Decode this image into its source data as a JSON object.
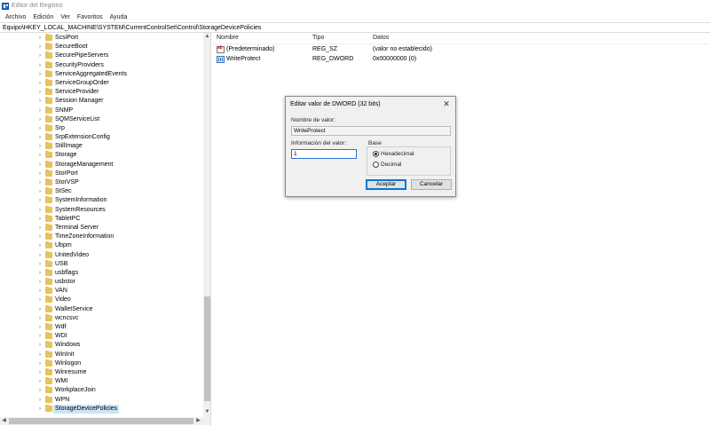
{
  "window": {
    "title": "Editor del Registro"
  },
  "menu": [
    "Archivo",
    "Edición",
    "Ver",
    "Favoritos",
    "Ayuda"
  ],
  "address": "Equipo\\HKEY_LOCAL_MACHINE\\SYSTEM\\CurrentControlSet\\Control\\StorageDevicePolicies",
  "tree": {
    "items": [
      "ScsiPort",
      "SecureBoot",
      "SecurePipeServers",
      "SecurityProviders",
      "ServiceAggregatedEvents",
      "ServiceGroupOrder",
      "ServiceProvider",
      "Session Manager",
      "SNMP",
      "SQMServiceList",
      "Srp",
      "SrpExtensionConfig",
      "StillImage",
      "Storage",
      "StorageManagement",
      "StorPort",
      "StorVSP",
      "StSec",
      "SystemInformation",
      "SystemResources",
      "TabletPC",
      "Terminal Server",
      "TimeZoneInformation",
      "Ubpm",
      "UnitedVideo",
      "USB",
      "usbflags",
      "usbstor",
      "VAN",
      "Video",
      "WalletService",
      "wcncsvc",
      "Wdf",
      "WDI",
      "Windows",
      "WinInit",
      "Winlogon",
      "Winresume",
      "WMI",
      "WorkplaceJoin",
      "WPN",
      "StorageDevicePolicies"
    ],
    "selected": "StorageDevicePolicies"
  },
  "list": {
    "columns": {
      "name": "Nombre",
      "type": "Tipo",
      "data": "Datos"
    },
    "rows": [
      {
        "name": "(Predeterminado)",
        "type": "REG_SZ",
        "data": "(valor no establecido)",
        "icon": "string-value-icon"
      },
      {
        "name": "WriteProtect",
        "type": "REG_DWORD",
        "data": "0x00000000 (0)",
        "icon": "dword-value-icon"
      }
    ]
  },
  "dialog": {
    "title": "Editar valor de DWORD (32 bits)",
    "close": "✕",
    "name_label": "Nombre de valor:",
    "name_value": "WriteProtect",
    "data_label": "Información del valor:",
    "data_value": "1",
    "base_label": "Base",
    "hex_label": "Hexadecimal",
    "dec_label": "Decimal",
    "base_selected": "Hexadecimal",
    "ok": "Aceptar",
    "cancel": "Cancelar"
  },
  "scroll": {
    "up": "▲",
    "down": "▼",
    "left": "◀",
    "right": "▶"
  },
  "tree_chevron": "›"
}
